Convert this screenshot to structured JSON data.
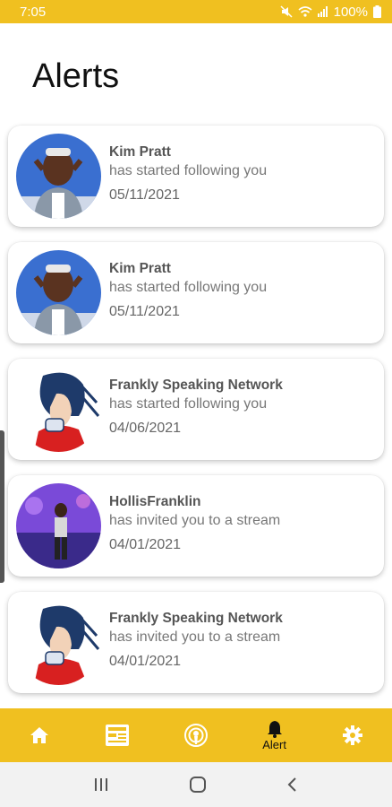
{
  "status_bar": {
    "time": "7:05",
    "battery": "100%"
  },
  "page": {
    "title": "Alerts"
  },
  "alerts": [
    {
      "name": "Kim Pratt",
      "message": "has started following you",
      "date": "05/11/2021",
      "avatar": "kim-pratt-photo"
    },
    {
      "name": "Kim Pratt",
      "message": "has started following you",
      "date": "05/11/2021",
      "avatar": "kim-pratt-photo"
    },
    {
      "name": "Frankly Speaking Network",
      "message": "has started following you",
      "date": "04/06/2021",
      "avatar": "frankly-speaking-illustration"
    },
    {
      "name": "HollisFranklin",
      "message": "has invited you to a stream",
      "date": "04/01/2021",
      "avatar": "hollis-franklin-photo"
    },
    {
      "name": "Frankly Speaking Network",
      "message": "has invited you to a stream",
      "date": "04/01/2021",
      "avatar": "frankly-speaking-illustration"
    }
  ],
  "bottom_nav": {
    "items": [
      {
        "icon": "home-icon",
        "label": ""
      },
      {
        "icon": "news-icon",
        "label": ""
      },
      {
        "icon": "broadcast-icon",
        "label": ""
      },
      {
        "icon": "bell-icon",
        "label": "Alert"
      },
      {
        "icon": "gear-icon",
        "label": ""
      }
    ]
  },
  "colors": {
    "accent": "#f0c020",
    "card_bg": "#ffffff",
    "nav_bg": "#f2f2f2"
  }
}
